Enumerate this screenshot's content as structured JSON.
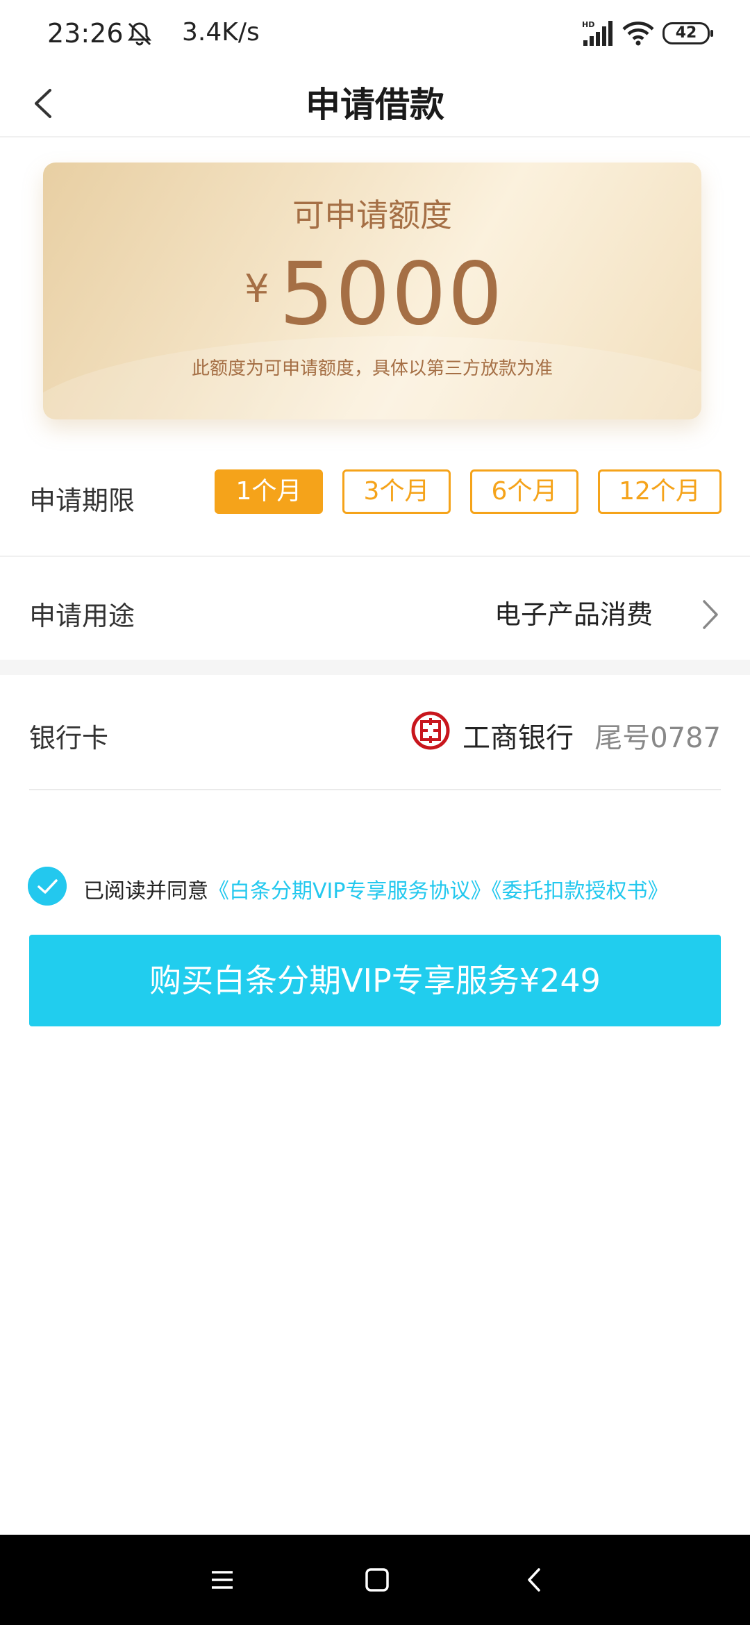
{
  "status_bar": {
    "time": "23:26",
    "net_speed": "3.4K/s",
    "battery": "42",
    "icons": [
      "bell-off-icon",
      "hd-signal-icon",
      "wifi-icon",
      "battery-icon"
    ]
  },
  "nav": {
    "title": "申请借款",
    "back_icon": "chevron-left-icon"
  },
  "credit": {
    "label": "可申请额度",
    "currency": "¥",
    "amount": "5000",
    "note": "此额度为可申请额度，具体以第三方放款为准"
  },
  "term": {
    "label": "申请期限",
    "options": [
      "1个月",
      "3个月",
      "6个月",
      "12个月"
    ],
    "selected_index": 0
  },
  "purpose": {
    "label": "申请用途",
    "value": "电子产品消费"
  },
  "bank": {
    "label": "银行卡",
    "name": "工商银行",
    "tail": "尾号0787",
    "logo_icon": "icbc-logo-icon"
  },
  "agreement": {
    "prefix": "已阅读并同意",
    "link1": "《白条分期VIP专享服务协议》",
    "link2": "《委托扣款授权书》",
    "checked": true
  },
  "buy_button": {
    "label": "购买白条分期VIP专享服务¥249"
  },
  "colors": {
    "accent_orange": "#f5a31a",
    "accent_cyan": "#21cdee",
    "card_text": "#a56f45"
  }
}
